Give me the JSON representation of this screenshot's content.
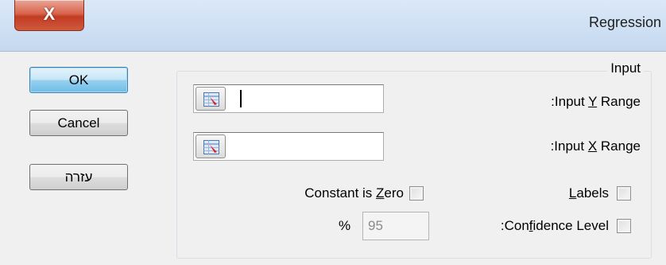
{
  "window": {
    "title": "Regression",
    "close_symbol": "X"
  },
  "buttons": {
    "ok": "OK",
    "cancel": "Cancel",
    "help": "עזרה"
  },
  "input_group": {
    "label": "Input",
    "y_range": {
      "label_pre": ":Input ",
      "label_key": "Y",
      "label_post": " Range",
      "value": ""
    },
    "x_range": {
      "label_pre": ":Input ",
      "label_key": "X",
      "label_post": " Range",
      "value": ""
    },
    "labels_option": {
      "label_key": "L",
      "label_rest": "abels",
      "checked": false
    },
    "constant_zero": {
      "label_pre": "Constant is ",
      "label_key": "Z",
      "label_post": "ero",
      "checked": false
    },
    "confidence": {
      "label_pre": ":Con",
      "label_key": "f",
      "label_post": "idence Level",
      "checked": false,
      "value": "95",
      "unit": "%"
    }
  },
  "icons": {
    "ref_button": "range-selector-icon"
  }
}
